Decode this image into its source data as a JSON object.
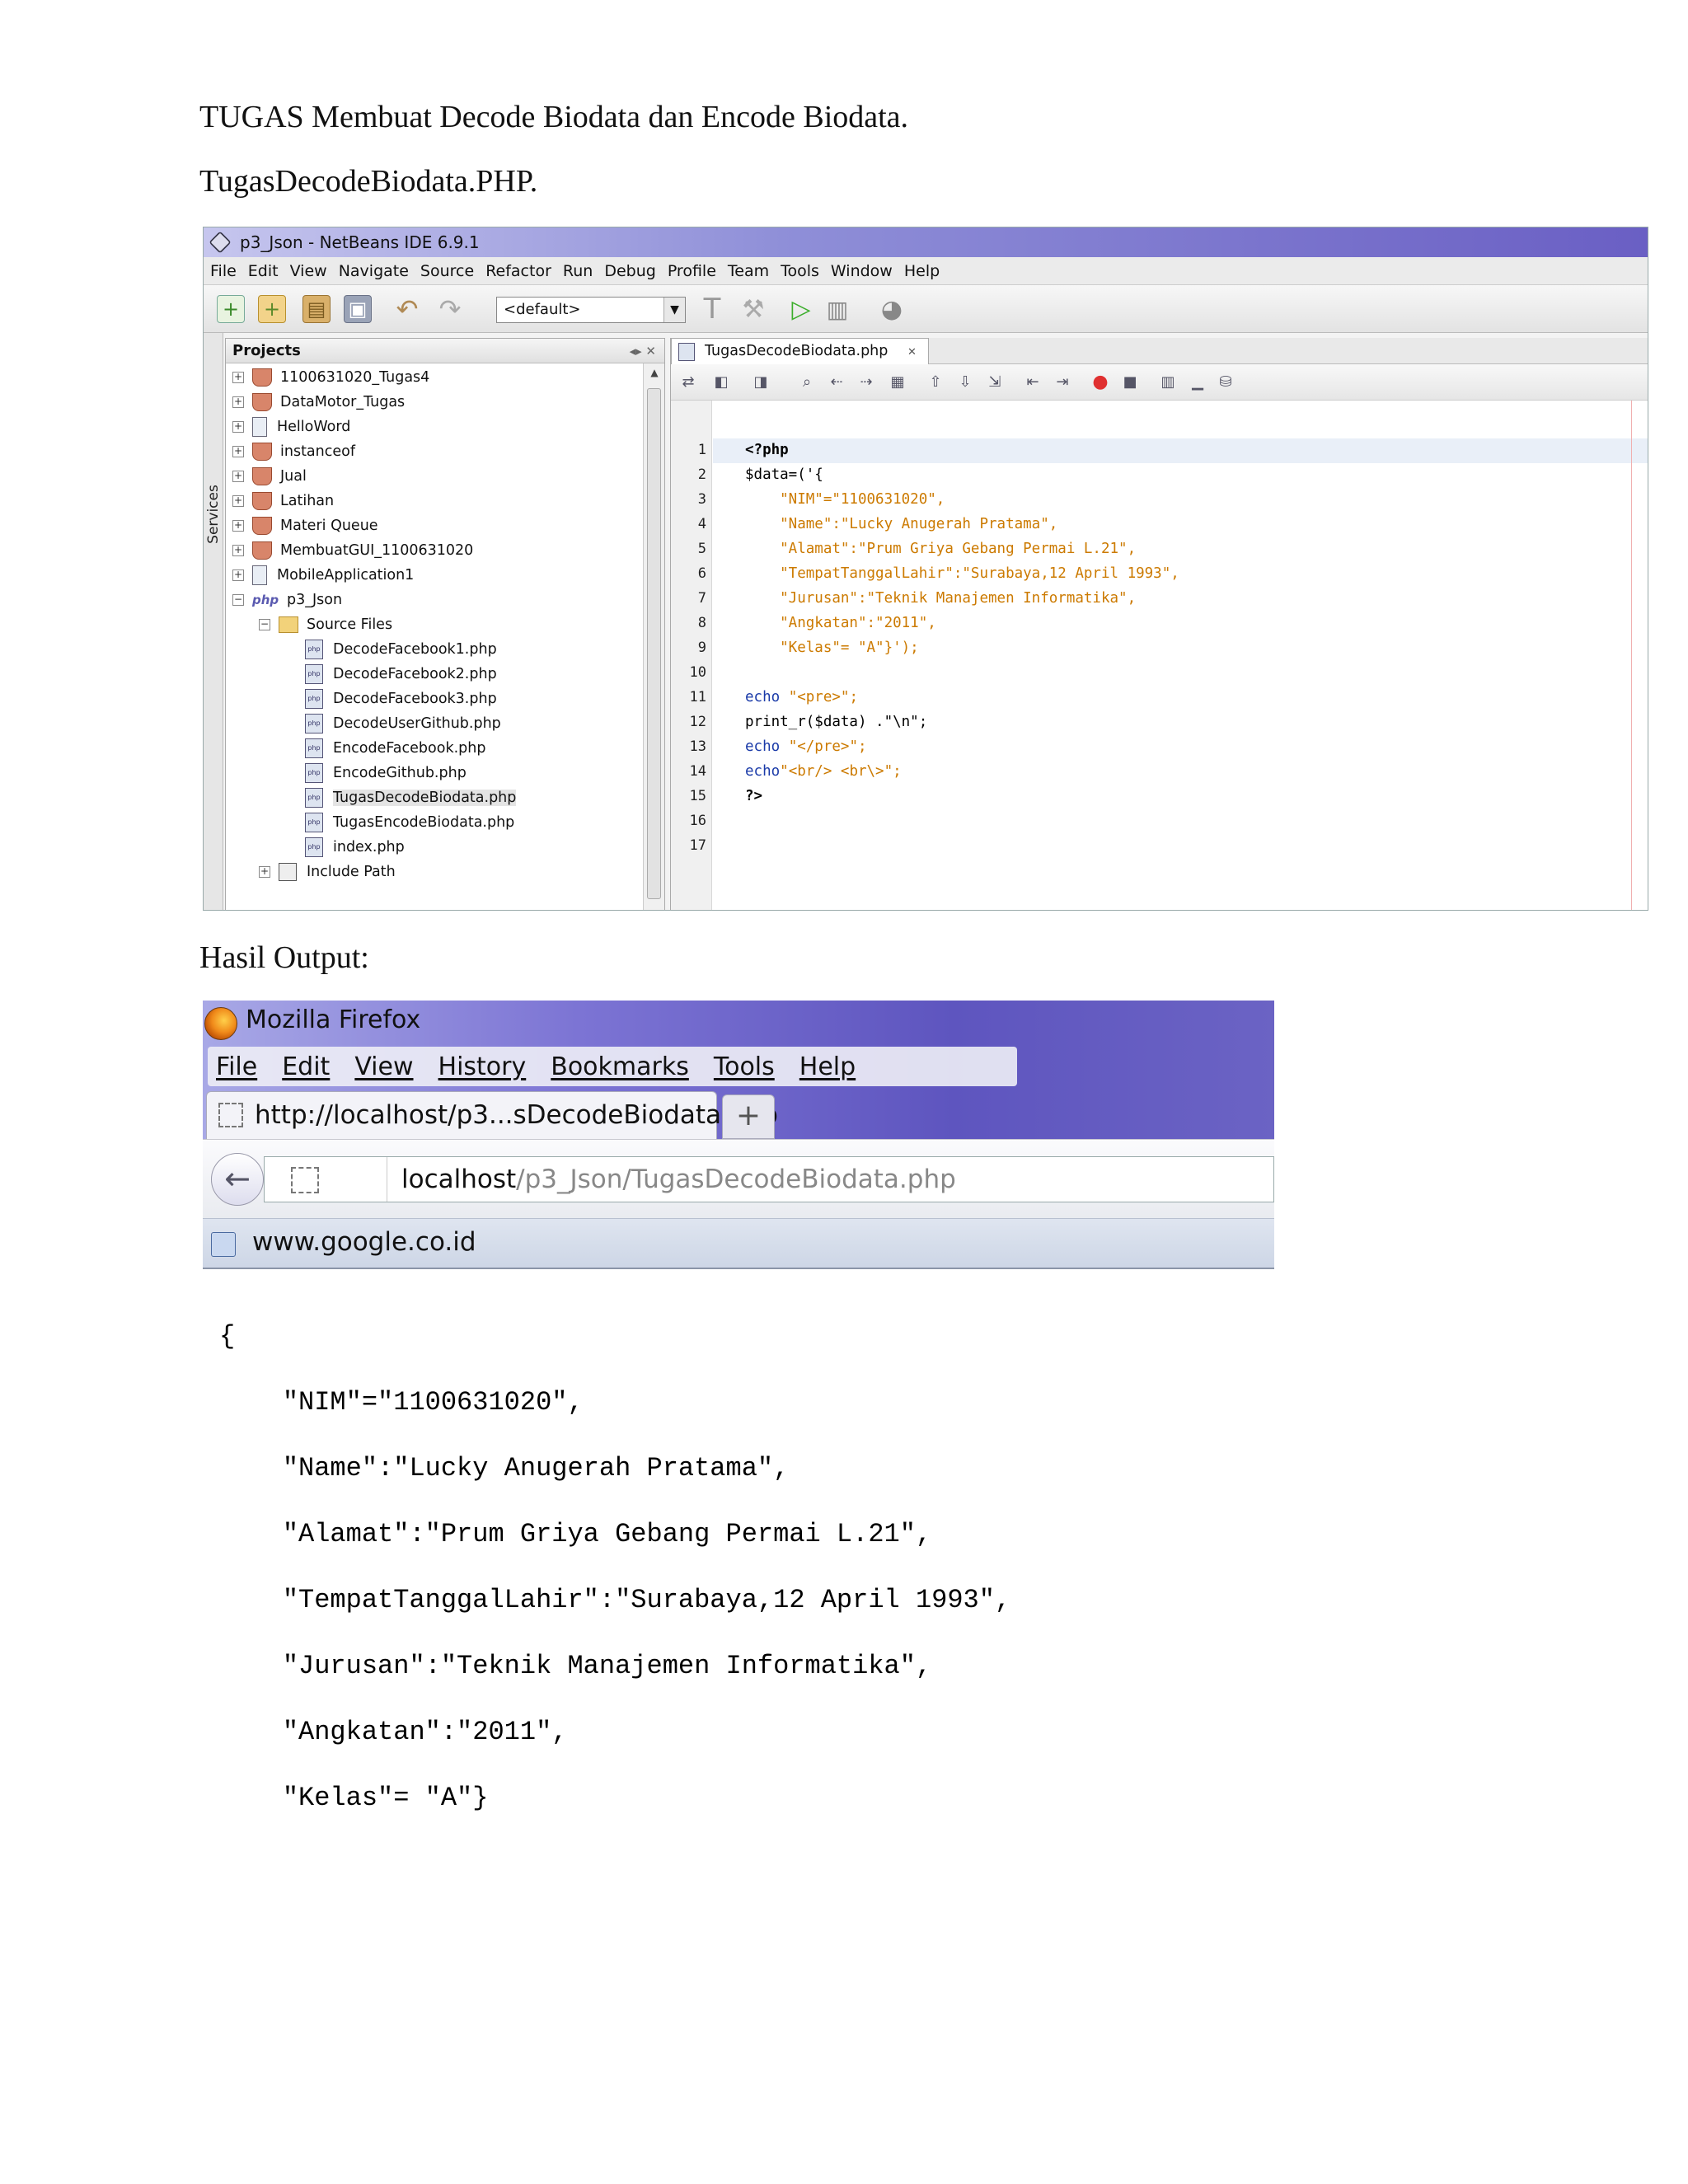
{
  "document": {
    "heading1": "TUGAS Membuat Decode Biodata dan Encode Biodata.",
    "heading2": "TugasDecodeBiodata.PHP.",
    "heading3": "Hasil Output:"
  },
  "netbeans": {
    "window_title": "p3_Json - NetBeans IDE 6.9.1",
    "menu": [
      "File",
      "Edit",
      "View",
      "Navigate",
      "Source",
      "Refactor",
      "Run",
      "Debug",
      "Profile",
      "Team",
      "Tools",
      "Window",
      "Help"
    ],
    "config_select": "<default>",
    "side_tab": "Services",
    "projects_panel_title": "Projects",
    "projects": [
      {
        "label": "1100631020_Tugas4",
        "icon": "coffee-cup-icon"
      },
      {
        "label": "DataMotor_Tugas",
        "icon": "coffee-cup-icon"
      },
      {
        "label": "HelloWord",
        "icon": "document-icon"
      },
      {
        "label": "instanceof",
        "icon": "coffee-cup-icon"
      },
      {
        "label": "Jual",
        "icon": "coffee-cup-icon"
      },
      {
        "label": "Latihan",
        "icon": "coffee-cup-icon"
      },
      {
        "label": "Materi Queue",
        "icon": "coffee-cup-icon"
      },
      {
        "label": "MembuatGUI_1100631020",
        "icon": "coffee-cup-icon"
      },
      {
        "label": "MobileApplication1",
        "icon": "document-icon"
      },
      {
        "label": "p3_Json",
        "icon": "php-icon"
      }
    ],
    "php_icon_text": "php",
    "source_files_label": "Source Files",
    "files": [
      "DecodeFacebook1.php",
      "DecodeFacebook2.php",
      "DecodeFacebook3.php",
      "DecodeUserGithub.php",
      "EncodeFacebook.php",
      "EncodeGithub.php",
      "TugasDecodeBiodata.php",
      "TugasEncodeBiodata.php",
      "index.php"
    ],
    "selected_file": "TugasDecodeBiodata.php",
    "include_path_label": "Include Path",
    "editor_tab": "TugasDecodeBiodata.php",
    "line_numbers": [
      "1",
      "2",
      "3",
      "4",
      "5",
      "6",
      "7",
      "8",
      "9",
      "10",
      "11",
      "12",
      "13",
      "14",
      "15",
      "16",
      "17"
    ],
    "code": {
      "l1": "<?php",
      "l2": "$data=('{",
      "l3": "    \"NIM\"=\"1100631020\",",
      "l4": "    \"Name\":\"Lucky Anugerah Pratama\",",
      "l5": "    \"Alamat\":\"Prum Griya Gebang Permai L.21\",",
      "l6": "    \"TempatTanggalLahir\":\"Surabaya,12 April 1993\",",
      "l7": "    \"Jurusan\":\"Teknik Manajemen Informatika\",",
      "l8": "    \"Angkatan\":\"2011\",",
      "l9": "    \"Kelas\"= \"A\"}');",
      "l11_kw": "echo",
      "l11_str": " \"<pre>\";",
      "l12": "print_r($data) .\"\\n\";",
      "l13_kw": "echo",
      "l13_str": " \"</pre>\";",
      "l14_kw": "echo",
      "l14_str": "\"<br/> <br\\>\";",
      "l15": "?>"
    }
  },
  "firefox": {
    "title": "Mozilla Firefox",
    "menu": [
      "File",
      "Edit",
      "View",
      "History",
      "Bookmarks",
      "Tools",
      "Help"
    ],
    "tab_title": "http://localhost/p3...sDecodeBiodata.php",
    "new_tab": "+",
    "back": "←",
    "url_host": "localhost",
    "url_path": "/p3_Json/TugasDecodeBiodata.php",
    "bookmark": "www.google.co.id"
  },
  "output": {
    "lines": [
      "{",
      "    \"NIM\"=\"1100631020\",",
      "    \"Name\":\"Lucky Anugerah Pratama\",",
      "    \"Alamat\":\"Prum Griya Gebang Permai L.21\",",
      "    \"TempatTanggalLahir\":\"Surabaya,12 April 1993\",",
      "    \"Jurusan\":\"Teknik Manajemen Informatika\",",
      "    \"Angkatan\":\"2011\",",
      "    \"Kelas\"= \"A\"}"
    ]
  }
}
